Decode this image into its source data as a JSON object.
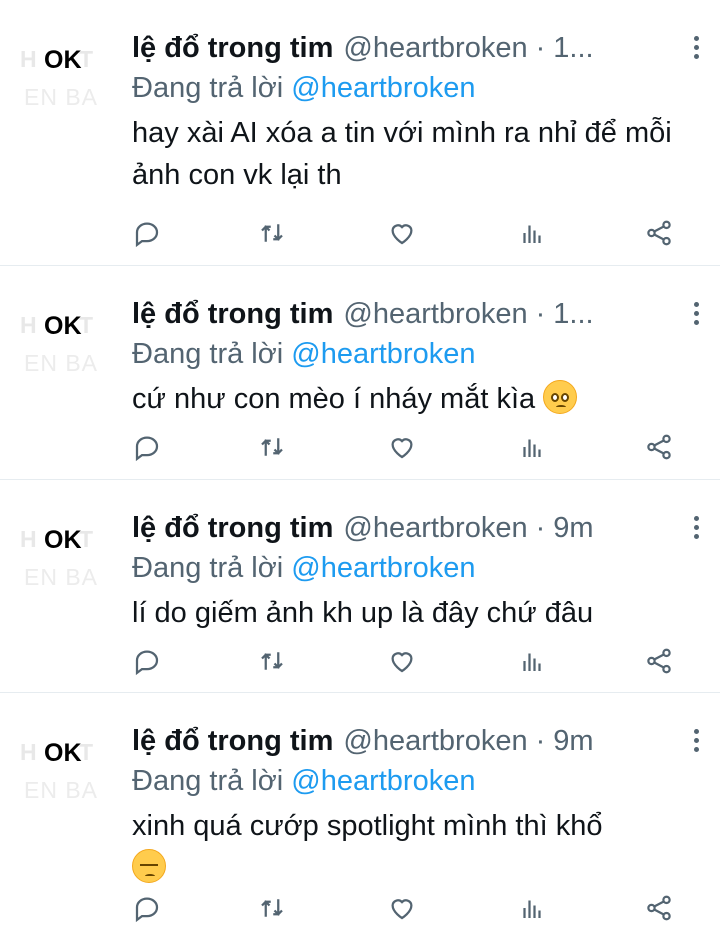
{
  "tweets": [
    {
      "avatar": {
        "label": "OK",
        "ghost_top": "H T",
        "ghost_bottom": "EN BA"
      },
      "name": "lệ đổ trong tim",
      "handle": "@heartbroken",
      "separator": "·",
      "time": "1...",
      "reply_prefix": "Đang trả lời",
      "reply_mention": "@heartbroken",
      "text": "hay xài AI xóa a tin với mình ra nhỉ để mỗi ảnh con vk lại th",
      "emoji": ""
    },
    {
      "avatar": {
        "label": "OK",
        "ghost_top": "H T",
        "ghost_bottom": "EN BA"
      },
      "name": "lệ đổ trong tim",
      "handle": "@heartbroken",
      "separator": "·",
      "time": "1...",
      "reply_prefix": "Đang trả lời",
      "reply_mention": "@heartbroken",
      "text": "cứ như con mèo í nháy mắt kìa",
      "emoji": "pleading-face"
    },
    {
      "avatar": {
        "label": "OK",
        "ghost_top": "H T",
        "ghost_bottom": "EN BA"
      },
      "name": "lệ đổ trong tim",
      "handle": "@heartbroken",
      "separator": "·",
      "time": "9m",
      "reply_prefix": "Đang trả lời",
      "reply_mention": "@heartbroken",
      "text": "lí do giếm ảnh kh up là đây chứ đâu",
      "emoji": ""
    },
    {
      "avatar": {
        "label": "OK",
        "ghost_top": "H T",
        "ghost_bottom": "EN BA"
      },
      "name": "lệ đổ trong tim",
      "handle": "@heartbroken",
      "separator": "·",
      "time": "9m",
      "reply_prefix": "Đang trả lời",
      "reply_mention": "@heartbroken",
      "text": "xinh quá cướp spotlight mình thì khổ",
      "emoji": "tired-face"
    }
  ],
  "action_icons": [
    "reply-icon",
    "retweet-icon",
    "like-icon",
    "views-icon",
    "share-icon"
  ],
  "colors": {
    "mention": "#1d9bf0",
    "muted": "#536471",
    "text": "#0f1419",
    "divider": "#e6ecf0"
  }
}
